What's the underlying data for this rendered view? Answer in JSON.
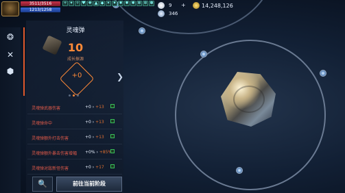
{
  "player": {
    "hp": "3511/3516",
    "mp": "1213/1258",
    "buff_icons": [
      "+",
      "✦",
      "✧",
      "♥",
      "✚",
      "▲",
      "◆",
      "✶",
      "✷",
      "✸",
      "✹",
      "✺",
      "✻",
      "✼",
      "✽"
    ]
  },
  "currencies": [
    {
      "icon": "pearl-icon",
      "value": "9",
      "color": "#e8eef8"
    },
    {
      "icon": "plus-icon",
      "value": "+",
      "color": "#c8d6ea"
    },
    {
      "icon": "gem-icon",
      "value": "346",
      "color": "#cfd9e8"
    },
    {
      "icon": "gold-coin-icon",
      "value": "14,248,126",
      "color": "#e8c24a"
    }
  ],
  "sidebar": {
    "items": [
      "star-cluster-icon",
      "crossed-swords-icon",
      "crystal-icon"
    ]
  },
  "panel": {
    "title": "灵魂弹",
    "level": "10",
    "subtitle": "成长振源",
    "core_value": "+0",
    "page_dots": 3,
    "active_dot": 1
  },
  "stats": [
    {
      "label": "灵魂弹武器伤害",
      "value": "+0",
      "bonus": "+13"
    },
    {
      "label": "灵魂弹命中",
      "value": "+0",
      "bonus": "+13"
    },
    {
      "label": "灵魂弹额外打击伤害",
      "value": "+0",
      "bonus": "+13"
    },
    {
      "label": "灵魂弹额外暴击伤害增幅",
      "value": "+0%",
      "bonus": "+85%"
    },
    {
      "label": "灵魂弹对敌新怪伤害",
      "value": "+0",
      "bonus": "+17"
    }
  ],
  "buttons": {
    "search": "🔍",
    "go": "前往当前阶段"
  },
  "accent": "#ff8a38"
}
